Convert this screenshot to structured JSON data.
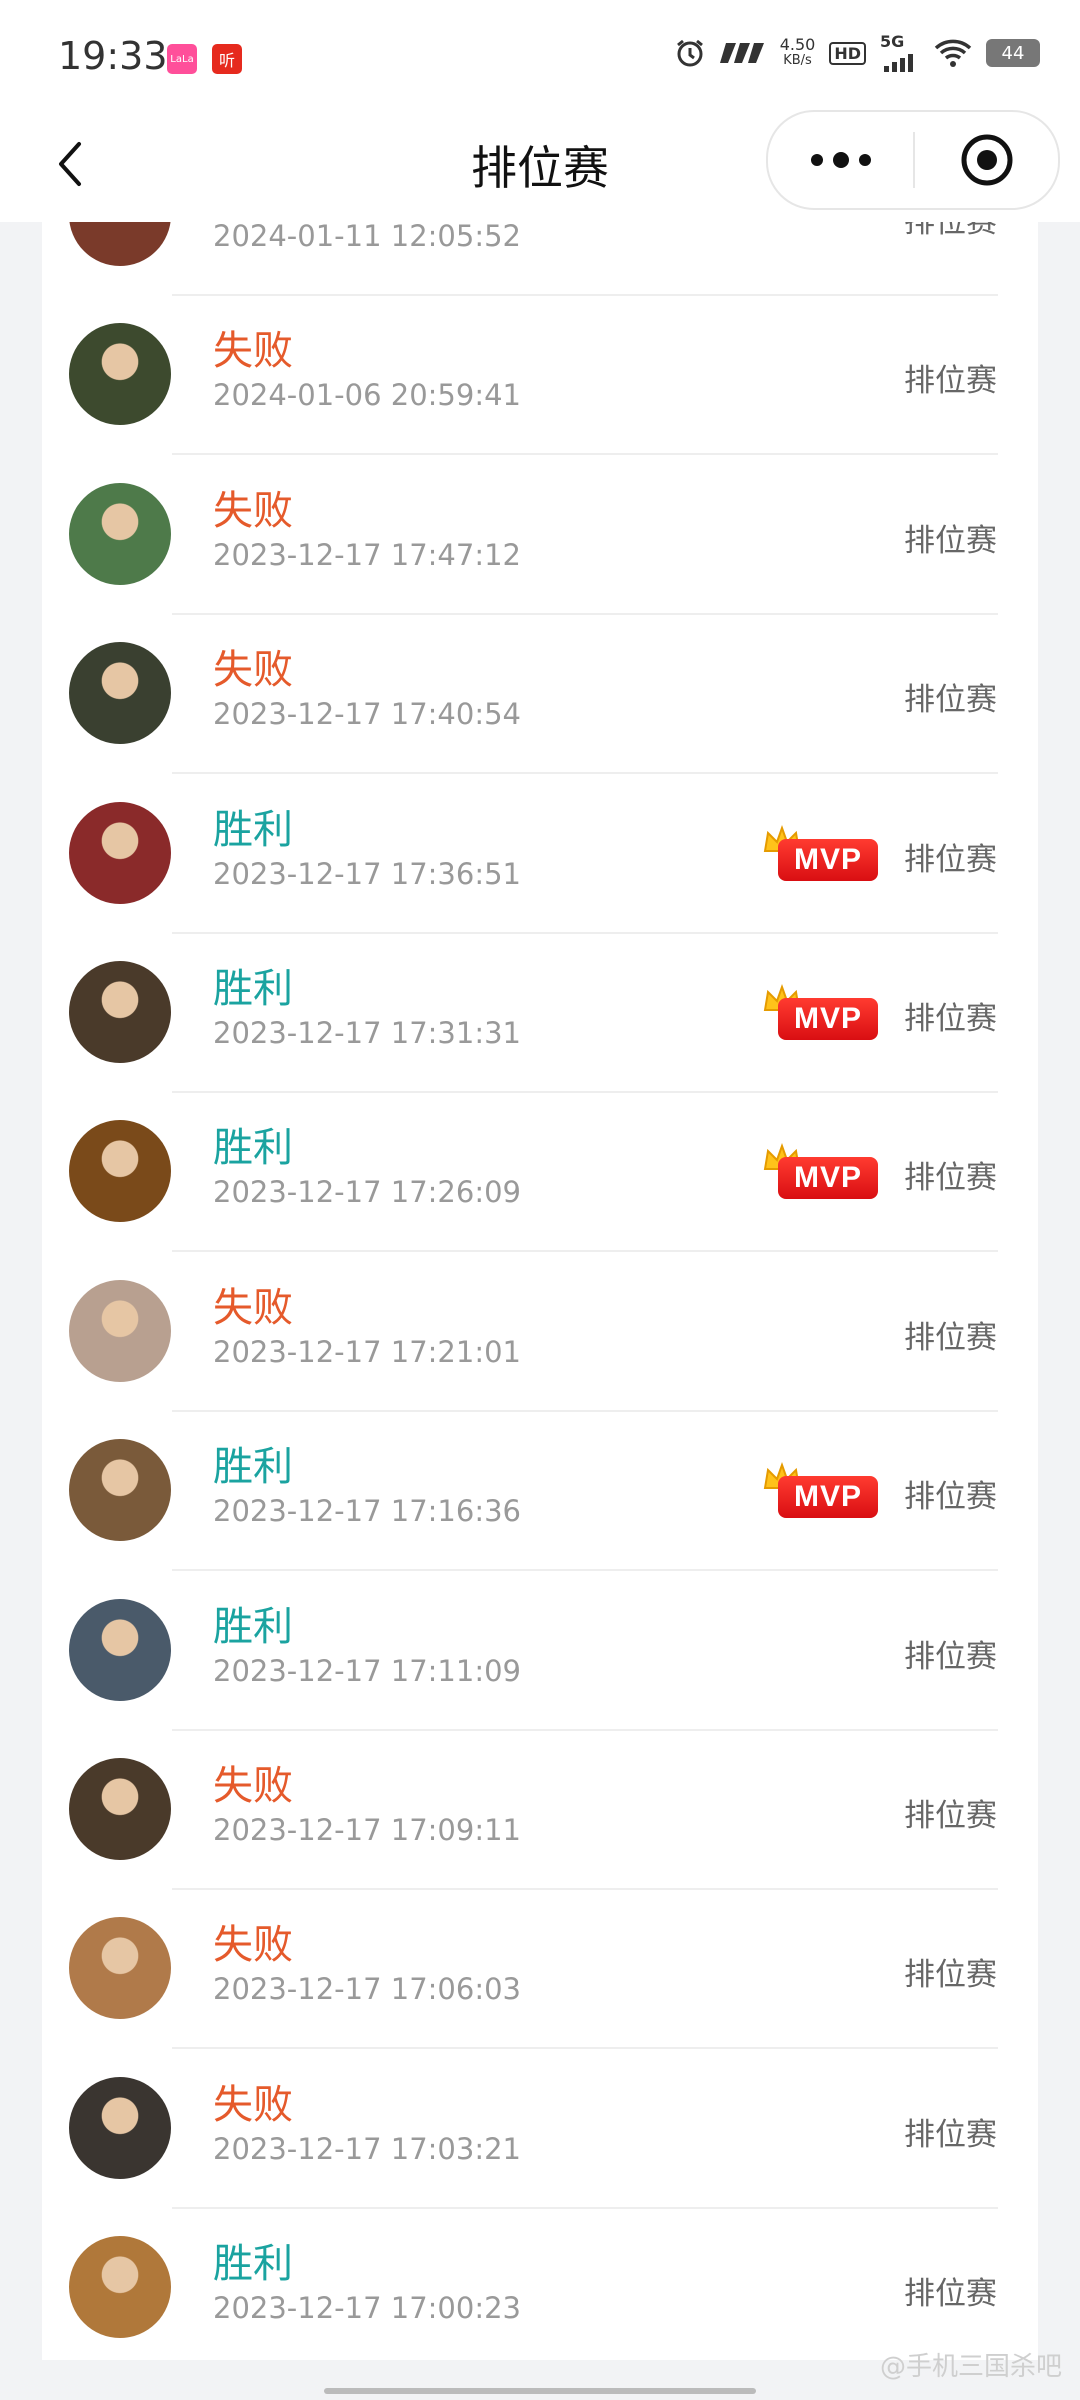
{
  "status_bar": {
    "time": "19:33",
    "app_badge_1": "LaLa",
    "app_badge_2": "听",
    "net_speed": "4.50",
    "net_unit": "KB/s",
    "hd": "HD",
    "network": "5G",
    "battery": "44"
  },
  "nav": {
    "title": "排位赛"
  },
  "records": [
    {
      "result": "",
      "time": "2024-01-11 12:05:52",
      "mode": "排位赛",
      "mvp": false,
      "avatar_color": "#7a3a2a"
    },
    {
      "result": "失败",
      "outcome": "lose",
      "time": "2024-01-06 20:59:41",
      "mode": "排位赛",
      "mvp": false,
      "avatar_color": "#3d4a2e"
    },
    {
      "result": "失败",
      "outcome": "lose",
      "time": "2023-12-17 17:47:12",
      "mode": "排位赛",
      "mvp": false,
      "avatar_color": "#4e7a4a"
    },
    {
      "result": "失败",
      "outcome": "lose",
      "time": "2023-12-17 17:40:54",
      "mode": "排位赛",
      "mvp": false,
      "avatar_color": "#3a4030"
    },
    {
      "result": "胜利",
      "outcome": "win",
      "time": "2023-12-17 17:36:51",
      "mode": "排位赛",
      "mvp": true,
      "avatar_color": "#8a2a2a"
    },
    {
      "result": "胜利",
      "outcome": "win",
      "time": "2023-12-17 17:31:31",
      "mode": "排位赛",
      "mvp": true,
      "avatar_color": "#4a3a2a"
    },
    {
      "result": "胜利",
      "outcome": "win",
      "time": "2023-12-17 17:26:09",
      "mode": "排位赛",
      "mvp": true,
      "avatar_color": "#7a4a1a"
    },
    {
      "result": "失败",
      "outcome": "lose",
      "time": "2023-12-17 17:21:01",
      "mode": "排位赛",
      "mvp": false,
      "avatar_color": "#b8a090"
    },
    {
      "result": "胜利",
      "outcome": "win",
      "time": "2023-12-17 17:16:36",
      "mode": "排位赛",
      "mvp": true,
      "avatar_color": "#7a5a3a"
    },
    {
      "result": "胜利",
      "outcome": "win",
      "time": "2023-12-17 17:11:09",
      "mode": "排位赛",
      "mvp": false,
      "avatar_color": "#4a5a6a"
    },
    {
      "result": "失败",
      "outcome": "lose",
      "time": "2023-12-17 17:09:11",
      "mode": "排位赛",
      "mvp": false,
      "avatar_color": "#4a3a2a"
    },
    {
      "result": "失败",
      "outcome": "lose",
      "time": "2023-12-17 17:06:03",
      "mode": "排位赛",
      "mvp": false,
      "avatar_color": "#b07a4a"
    },
    {
      "result": "失败",
      "outcome": "lose",
      "time": "2023-12-17 17:03:21",
      "mode": "排位赛",
      "mvp": false,
      "avatar_color": "#3a3530"
    },
    {
      "result": "胜利",
      "outcome": "win",
      "time": "2023-12-17 17:00:23",
      "mode": "排位赛",
      "mvp": false,
      "avatar_color": "#b0783a"
    }
  ],
  "mvp_label": "MVP",
  "watermark": "@手机三国杀吧",
  "colors": {
    "win": "#1aa3a0",
    "lose": "#e55a2b",
    "mvp": "#e8191a"
  }
}
